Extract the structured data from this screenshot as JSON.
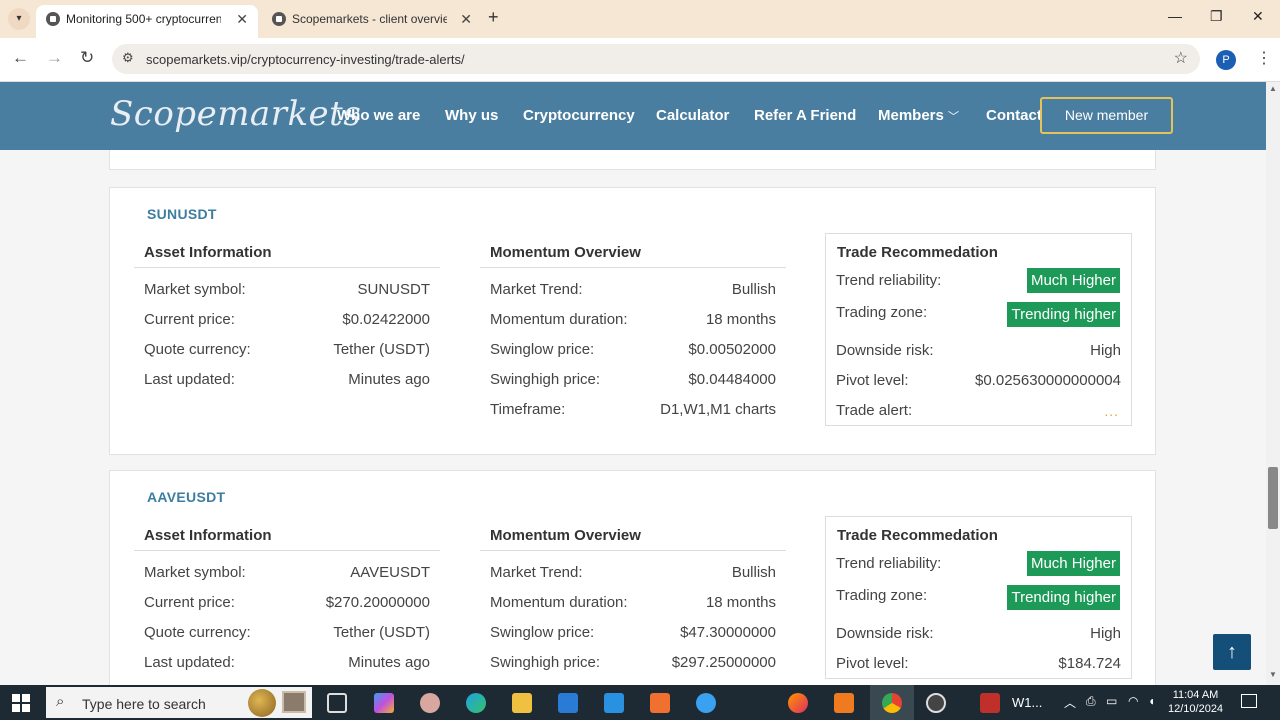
{
  "browser": {
    "tabs": [
      {
        "title": "Monitoring 500+ cryptocurrenc",
        "active": true
      },
      {
        "title": "Scopemarkets - client overview",
        "active": false
      }
    ],
    "url": "scopemarkets.vip/cryptocurrency-investing/trade-alerts/",
    "profile_initial": "P"
  },
  "site": {
    "logo": "Scopemarkets",
    "nav": [
      "Who we are",
      "Why us",
      "Cryptocurrency",
      "Calculator",
      "Refer A Friend",
      "Members",
      "Contact"
    ],
    "cta": "New member"
  },
  "cards": [
    {
      "symbol": "SUNUSDT",
      "asset_info": {
        "heading": "Asset Information",
        "rows": [
          {
            "label": "Market symbol:",
            "value": "SUNUSDT"
          },
          {
            "label": "Current price:",
            "value": "$0.02422000"
          },
          {
            "label": "Quote currency:",
            "value": "Tether (USDT)"
          },
          {
            "label": "Last updated:",
            "value": "Minutes ago"
          }
        ]
      },
      "momentum": {
        "heading": "Momentum Overview",
        "rows": [
          {
            "label": "Market Trend:",
            "value": "Bullish"
          },
          {
            "label": "Momentum duration:",
            "value": "18 months"
          },
          {
            "label": "Swinglow price:",
            "value": "$0.00502000"
          },
          {
            "label": "Swinghigh price:",
            "value": "$0.04484000"
          },
          {
            "label": "Timeframe:",
            "value": "D1,W1,M1 charts"
          }
        ]
      },
      "recommendation": {
        "heading": "Trade Recommedation",
        "reliability_label": "Trend reliability:",
        "reliability_value": "Much Higher",
        "zone_label": "Trading zone:",
        "zone_value": "Trending higher",
        "downside_label": "Downside risk:",
        "downside_value": "High",
        "pivot_label": "Pivot level:",
        "pivot_value": "$0.025630000000004",
        "alert_label": "Trade alert:",
        "alert_value": "..."
      }
    },
    {
      "symbol": "AAVEUSDT",
      "asset_info": {
        "heading": "Asset Information",
        "rows": [
          {
            "label": "Market symbol:",
            "value": "AAVEUSDT"
          },
          {
            "label": "Current price:",
            "value": "$270.20000000"
          },
          {
            "label": "Quote currency:",
            "value": "Tether (USDT)"
          },
          {
            "label": "Last updated:",
            "value": "Minutes ago"
          }
        ]
      },
      "momentum": {
        "heading": "Momentum Overview",
        "rows": [
          {
            "label": "Market Trend:",
            "value": "Bullish"
          },
          {
            "label": "Momentum duration:",
            "value": "18 months"
          },
          {
            "label": "Swinglow price:",
            "value": "$47.30000000"
          },
          {
            "label": "Swinghigh price:",
            "value": "$297.25000000"
          }
        ]
      },
      "recommendation": {
        "heading": "Trade Recommedation",
        "reliability_label": "Trend reliability:",
        "reliability_value": "Much Higher",
        "zone_label": "Trading zone:",
        "zone_value": "Trending higher",
        "downside_label": "Downside risk:",
        "downside_value": "High",
        "pivot_label": "Pivot level:",
        "pivot_value": "$184.724"
      }
    }
  ],
  "taskbar": {
    "search_placeholder": "Type here to search",
    "active_label": "W1...",
    "time": "11:04 AM",
    "date": "12/10/2024"
  },
  "colors": {
    "header_bg": "#4a7ea0",
    "badge_green": "#1e9a58",
    "cta_border": "#e6c25a",
    "symbol_blue": "#3d7ea0"
  }
}
